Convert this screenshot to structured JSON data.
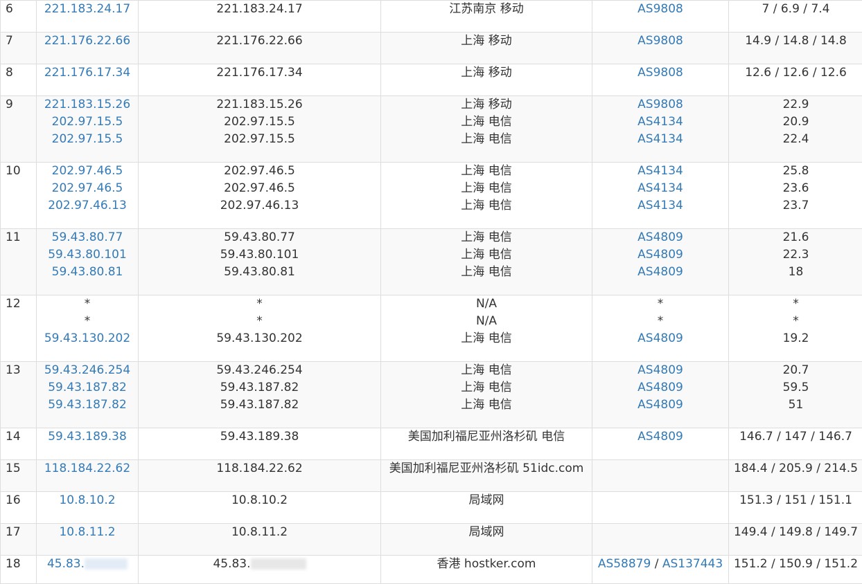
{
  "rows": [
    {
      "hop": "6",
      "ips": [
        "221.183.24.17"
      ],
      "hosts": [
        "221.183.24.17"
      ],
      "locs": [
        "江苏南京 移动"
      ],
      "asns": [
        "AS9808"
      ],
      "times": [
        "7 / 6.9 / 7.4"
      ]
    },
    {
      "hop": "7",
      "ips": [
        "221.176.22.66"
      ],
      "hosts": [
        "221.176.22.66"
      ],
      "locs": [
        "上海 移动"
      ],
      "asns": [
        "AS9808"
      ],
      "times": [
        "14.9 / 14.8 / 14.8"
      ]
    },
    {
      "hop": "8",
      "ips": [
        "221.176.17.34"
      ],
      "hosts": [
        "221.176.17.34"
      ],
      "locs": [
        "上海 移动"
      ],
      "asns": [
        "AS9808"
      ],
      "times": [
        "12.6 / 12.6 / 12.6"
      ]
    },
    {
      "hop": "9",
      "ips": [
        "221.183.15.26",
        "202.97.15.5",
        "202.97.15.5"
      ],
      "hosts": [
        "221.183.15.26",
        "202.97.15.5",
        "202.97.15.5"
      ],
      "locs": [
        "上海 移动",
        "上海 电信",
        "上海 电信"
      ],
      "asns": [
        "AS9808",
        "AS4134",
        "AS4134"
      ],
      "times": [
        "22.9",
        "20.9",
        "22.4"
      ]
    },
    {
      "hop": "10",
      "ips": [
        "202.97.46.5",
        "202.97.46.5",
        "202.97.46.13"
      ],
      "hosts": [
        "202.97.46.5",
        "202.97.46.5",
        "202.97.46.13"
      ],
      "locs": [
        "上海 电信",
        "上海 电信",
        "上海 电信"
      ],
      "asns": [
        "AS4134",
        "AS4134",
        "AS4134"
      ],
      "times": [
        "25.8",
        "23.6",
        "23.7"
      ]
    },
    {
      "hop": "11",
      "ips": [
        "59.43.80.77",
        "59.43.80.101",
        "59.43.80.81"
      ],
      "hosts": [
        "59.43.80.77",
        "59.43.80.101",
        "59.43.80.81"
      ],
      "locs": [
        "上海 电信",
        "上海 电信",
        "上海 电信"
      ],
      "asns": [
        "AS4809",
        "AS4809",
        "AS4809"
      ],
      "times": [
        "21.6",
        "22.3",
        "18"
      ]
    },
    {
      "hop": "12",
      "ips": [
        "*",
        "*",
        "59.43.130.202"
      ],
      "hosts": [
        "*",
        "*",
        "59.43.130.202"
      ],
      "locs": [
        "N/A",
        "N/A",
        "上海 电信"
      ],
      "asns": [
        "*",
        "*",
        "AS4809"
      ],
      "times": [
        "*",
        "*",
        "19.2"
      ]
    },
    {
      "hop": "13",
      "ips": [
        "59.43.246.254",
        "59.43.187.82",
        "59.43.187.82"
      ],
      "hosts": [
        "59.43.246.254",
        "59.43.187.82",
        "59.43.187.82"
      ],
      "locs": [
        "上海 电信",
        "上海 电信",
        "上海 电信"
      ],
      "asns": [
        "AS4809",
        "AS4809",
        "AS4809"
      ],
      "times": [
        "20.7",
        "59.5",
        "51"
      ]
    },
    {
      "hop": "14",
      "ips": [
        "59.43.189.38"
      ],
      "hosts": [
        "59.43.189.38"
      ],
      "locs": [
        "美国加利福尼亚州洛杉矶 电信"
      ],
      "asns": [
        "AS4809"
      ],
      "times": [
        "146.7 / 147 / 146.7"
      ]
    },
    {
      "hop": "15",
      "ips": [
        "118.184.22.62"
      ],
      "hosts": [
        "118.184.22.62"
      ],
      "locs": [
        "美国加利福尼亚州洛杉矶 51idc.com"
      ],
      "asns": [
        ""
      ],
      "times": [
        "184.4 / 205.9 / 214.5"
      ]
    },
    {
      "hop": "16",
      "ips": [
        "10.8.10.2"
      ],
      "hosts": [
        "10.8.10.2"
      ],
      "locs": [
        "局域网"
      ],
      "asns": [
        ""
      ],
      "times": [
        "151.3 / 151 / 151.1"
      ]
    },
    {
      "hop": "17",
      "ips": [
        "10.8.11.2"
      ],
      "hosts": [
        "10.8.11.2"
      ],
      "locs": [
        "局域网"
      ],
      "asns": [
        ""
      ],
      "times": [
        "149.4 / 149.8 / 149.7"
      ]
    }
  ],
  "last_row": {
    "hop": "18",
    "ip_prefix": "45.83.",
    "host_prefix": "45.83.",
    "loc": "香港 hostker.com",
    "asn1": "AS58879",
    "asn_sep": " / ",
    "asn2": "AS137443",
    "time": "151.2 / 150.9 / 151.2"
  },
  "colors": {
    "link": "#337ab7",
    "text": "#333333",
    "stripe": "#f9f9f9",
    "border": "#dddddd"
  }
}
